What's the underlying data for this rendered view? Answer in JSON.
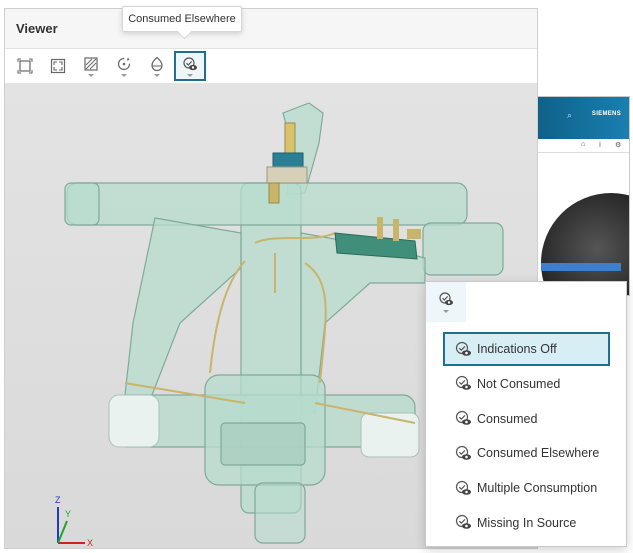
{
  "viewer": {
    "title": "Viewer"
  },
  "toolbar": {
    "buttons": [
      {
        "icon": "fit-view-icon"
      },
      {
        "icon": "fullscreen-icon"
      },
      {
        "icon": "display-mode-icon"
      },
      {
        "icon": "rotate-icon"
      },
      {
        "icon": "section-icon"
      },
      {
        "icon": "consumption-indication-icon"
      }
    ]
  },
  "tooltip": {
    "text": "Consumed Elsewhere"
  },
  "background_app": {
    "brand": "SIEMENS"
  },
  "axis_triad": {
    "x": "X",
    "y": "Y",
    "z": "Z"
  },
  "menu": {
    "items": [
      {
        "label": "Indications Off",
        "selected": true
      },
      {
        "label": "Not Consumed",
        "selected": false
      },
      {
        "label": "Consumed",
        "selected": false
      },
      {
        "label": "Consumed Elsewhere",
        "selected": false
      },
      {
        "label": "Multiple Consumption",
        "selected": false
      },
      {
        "label": "Missing In Source",
        "selected": false
      }
    ]
  },
  "colors": {
    "accent": "#1f6f93",
    "selected_bg": "#d7eef4",
    "model_fill": "#b7dccd",
    "model_stroke": "#7fa99a",
    "brass": "#c8b46a"
  }
}
